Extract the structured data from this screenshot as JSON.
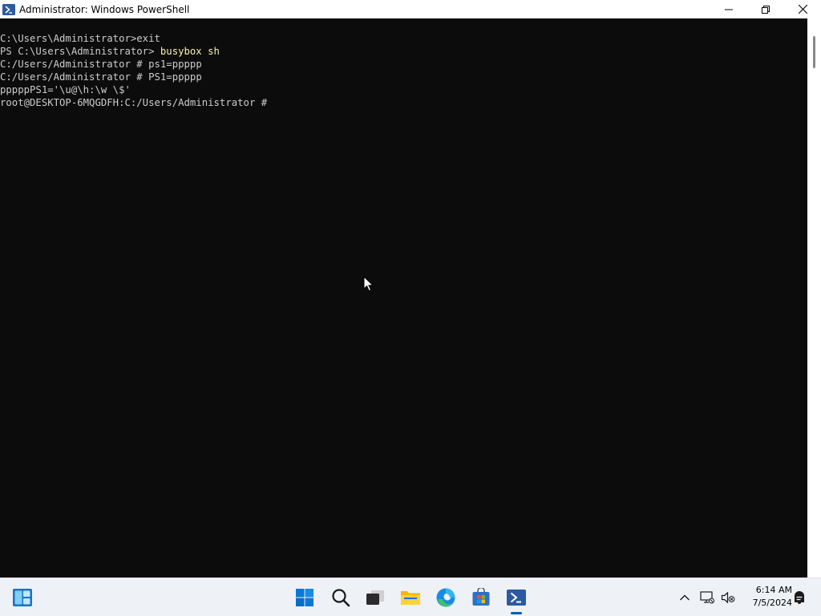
{
  "window": {
    "title": "Administrator: Windows PowerShell",
    "icon": "powershell-icon",
    "controls": [
      "minimize-icon",
      "restore-icon",
      "close-icon"
    ]
  },
  "terminal": {
    "lines": [
      {
        "prompt": "C:\\Users\\Administrator>",
        "command": "exit",
        "highlight": false
      },
      {
        "prompt": "PS C:\\Users\\Administrator> ",
        "command": "busybox sh",
        "highlight": true
      },
      {
        "prompt": "C:/Users/Administrator # ",
        "command": "ps1=ppppp",
        "highlight": false
      },
      {
        "prompt": "C:/Users/Administrator # ",
        "command": "PS1=ppppp",
        "highlight": false
      },
      {
        "prompt": "pppppPS1='\\u@\\h:\\w \\$'",
        "command": "",
        "highlight": false
      },
      {
        "prompt": "root@DESKTOP-6MQGDFH:C:/Users/Administrator # ",
        "command": "",
        "highlight": false
      }
    ],
    "colors": {
      "background": "#0c0c0c",
      "text": "#cccccc",
      "command": "#f9f1a5"
    }
  },
  "taskbar": {
    "widgets": "widgets-icon",
    "apps": [
      {
        "name": "start-icon"
      },
      {
        "name": "search-icon"
      },
      {
        "name": "task-view-icon"
      },
      {
        "name": "file-explorer-icon"
      },
      {
        "name": "edge-icon"
      },
      {
        "name": "store-icon"
      },
      {
        "name": "powershell-icon",
        "active": true
      }
    ],
    "tray": [
      "chevron-up-icon",
      "network-icon",
      "volume-muted-icon",
      "notification-icon"
    ],
    "clock": {
      "time": "6:14 AM",
      "date": "7/5/2024"
    }
  }
}
